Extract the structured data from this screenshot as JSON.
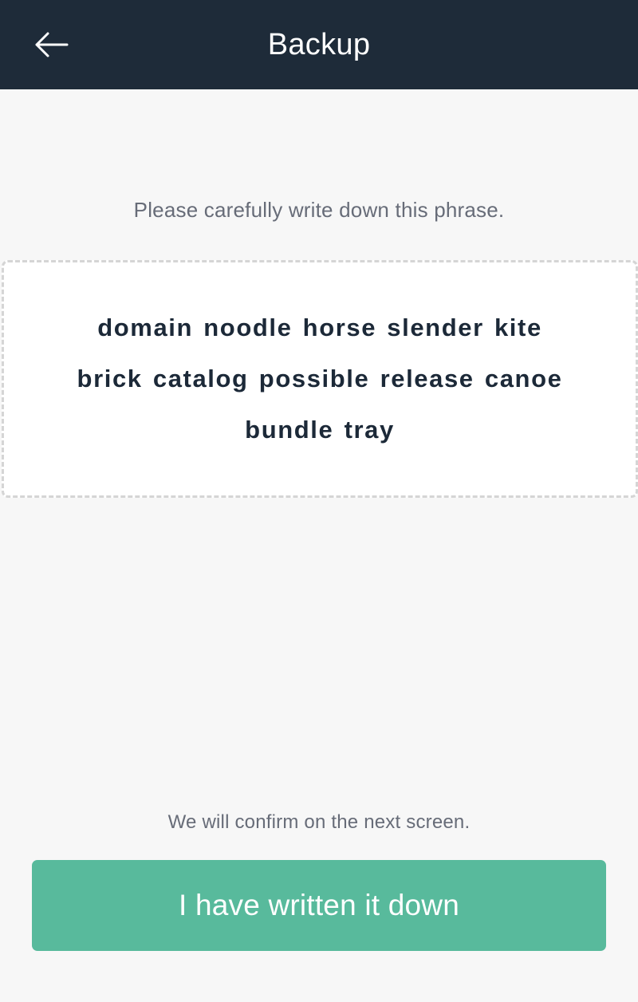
{
  "header": {
    "title": "Backup",
    "back_icon": "arrow-left-icon",
    "background_color": "#1e2b39"
  },
  "main": {
    "instruction": "Please carefully write down this phrase.",
    "recovery_phrase": "domain noodle horse slender kite brick catalog possible release canoe bundle tray",
    "confirm_note": "We will confirm on the next screen."
  },
  "actions": {
    "primary_button_label": "I have written it down",
    "primary_button_color": "#58ba9c"
  }
}
